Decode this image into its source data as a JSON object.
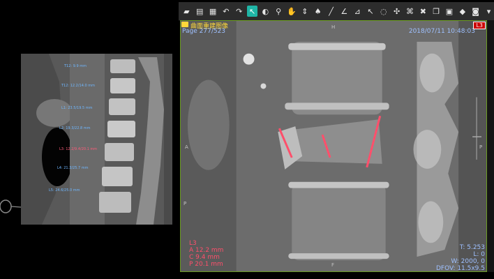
{
  "thumbnail": {
    "labels": [
      {
        "text": "T12: 9.9 mm",
        "red": false
      },
      {
        "text": "T12: 12.2/14.0 mm",
        "red": false
      },
      {
        "text": "L1: 23.5/19.5 mm",
        "red": false
      },
      {
        "text": "L2: 19.3/22.8 mm",
        "red": false
      },
      {
        "text": "L3: 12.2/9.4/20.1 mm",
        "red": true
      },
      {
        "text": "L4: 21.3/25.7 mm",
        "red": false
      },
      {
        "text": "L5: 24.6/25.0 mm",
        "red": false
      }
    ]
  },
  "toolbar": {
    "tools": [
      {
        "name": "open-folder-icon",
        "glyph": "▰",
        "active": false
      },
      {
        "name": "print-icon",
        "glyph": "▤",
        "active": false
      },
      {
        "name": "layout-grid-icon",
        "glyph": "▦",
        "active": false
      },
      {
        "name": "undo-icon",
        "glyph": "↶",
        "active": false
      },
      {
        "name": "redo-icon",
        "glyph": "↷",
        "active": false
      },
      {
        "name": "pointer-tool-icon",
        "glyph": "↖",
        "active": true
      },
      {
        "name": "window-level-icon",
        "glyph": "◐",
        "active": false
      },
      {
        "name": "zoom-icon",
        "glyph": "⚲",
        "active": false
      },
      {
        "name": "pan-hand-icon",
        "glyph": "✋",
        "active": false
      },
      {
        "name": "scroll-stack-icon",
        "glyph": "⇕",
        "active": false
      },
      {
        "name": "spine-label-icon",
        "glyph": "♠",
        "active": false
      },
      {
        "name": "ruler-icon",
        "glyph": "╱",
        "active": false
      },
      {
        "name": "angle-icon",
        "glyph": "∠",
        "active": false
      },
      {
        "name": "cobb-angle-icon",
        "glyph": "⊿",
        "active": false
      },
      {
        "name": "arrow-annotation-icon",
        "glyph": "↖",
        "active": false
      },
      {
        "name": "freehand-roi-icon",
        "glyph": "◌",
        "active": false
      },
      {
        "name": "crosshair-icon",
        "glyph": "✣",
        "active": false
      },
      {
        "name": "spine-auto-icon",
        "glyph": "⌘",
        "active": false
      },
      {
        "name": "delete-annotation-icon",
        "glyph": "✖",
        "active": false
      },
      {
        "name": "copy-image-icon",
        "glyph": "❐",
        "active": false
      },
      {
        "name": "save-image-icon",
        "glyph": "▣",
        "active": false
      },
      {
        "name": "key-image-icon",
        "glyph": "◆",
        "active": false
      },
      {
        "name": "camera-icon",
        "glyph": "◙",
        "active": false
      },
      {
        "name": "more-dropdown-icon",
        "glyph": "▾",
        "active": false
      }
    ]
  },
  "viewport": {
    "series_title": "曲面重建图像",
    "page": "Page 277/523",
    "datetime": "2018/07/11 10:48:03",
    "level_badge": "L3",
    "measurements": {
      "level": "L3",
      "a": "A 12.2 mm",
      "c": "C  9.4 mm",
      "p": "P 20.1 mm"
    },
    "info": {
      "line1": "T: 5.253",
      "line2": "L: 0",
      "line3": "W: 2000, 0",
      "line4": "DFOV: 11.5x9.5"
    },
    "orientation": {
      "top": "H",
      "bottom": "F",
      "left": "A",
      "right": "P",
      "left_lower": "P"
    }
  },
  "colors": {
    "measurement_line": "#ff4f6b",
    "overlay_text": "#9ec0ff",
    "viewport_border": "#6b9b22",
    "active_tool": "#1fb5a6"
  }
}
